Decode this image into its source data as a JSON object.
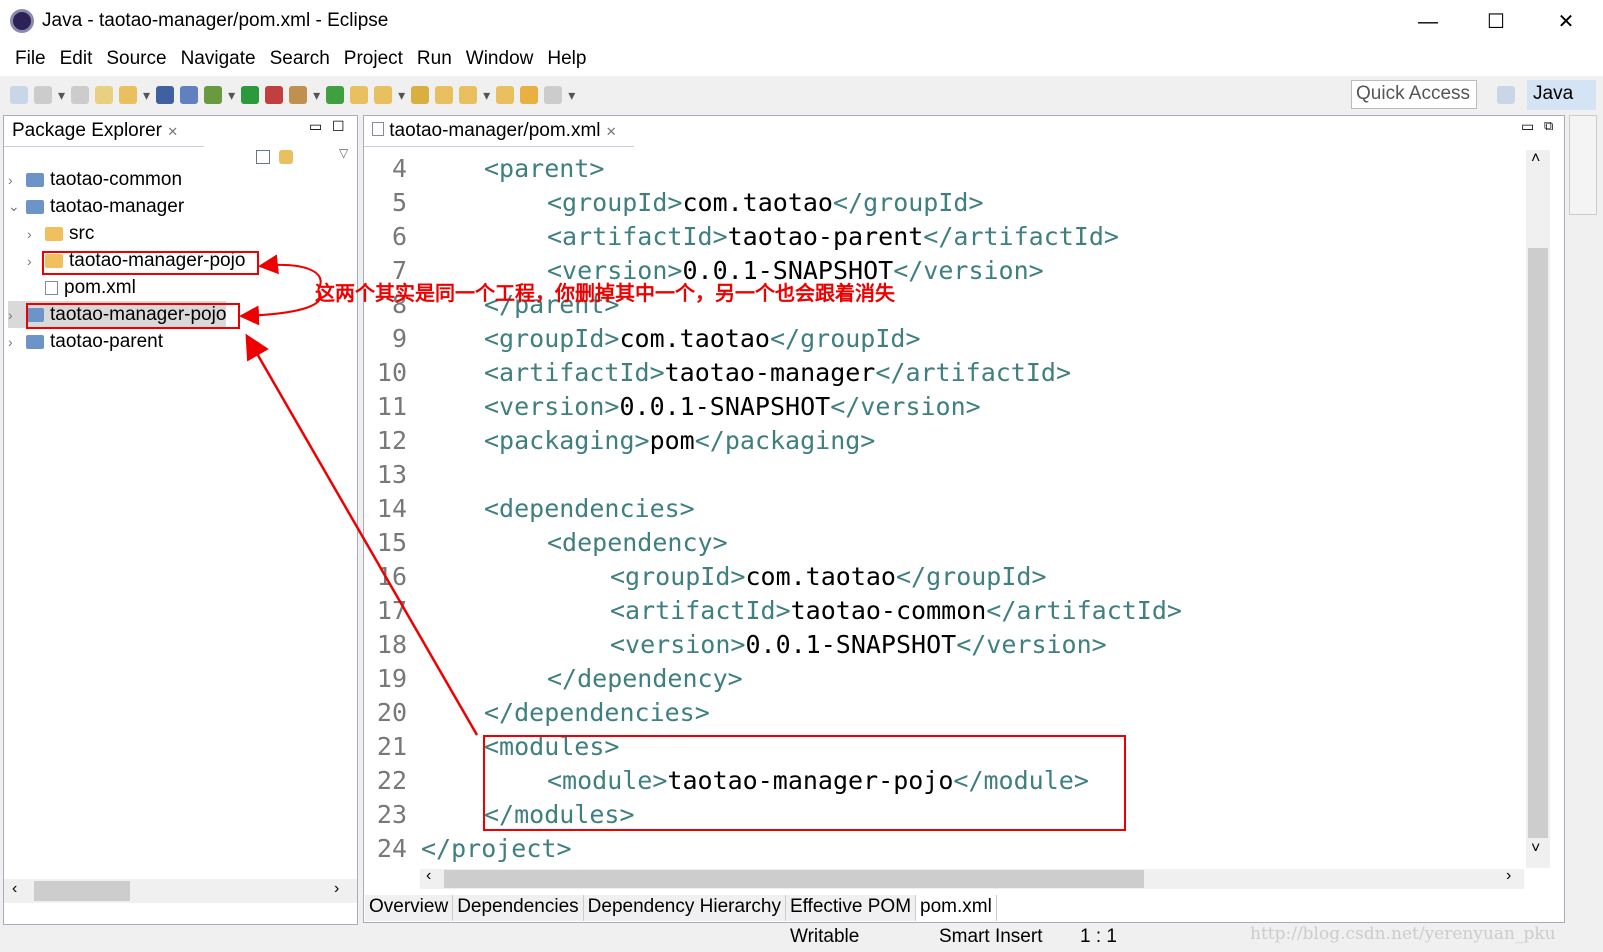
{
  "window": {
    "title": "Java - taotao-manager/pom.xml - Eclipse",
    "minimize": "—",
    "maximize": "☐",
    "close": "✕"
  },
  "menu": [
    "File",
    "Edit",
    "Source",
    "Navigate",
    "Search",
    "Project",
    "Run",
    "Window",
    "Help"
  ],
  "toolbar": {
    "quick_access": "Quick Access",
    "perspective": "Java"
  },
  "package_explorer": {
    "title": "Package Explorer",
    "items": [
      {
        "label": "taotao-common",
        "icon": "maven-project-icon",
        "expanded": false
      },
      {
        "label": "taotao-manager",
        "icon": "maven-project-icon",
        "expanded": true
      },
      {
        "label": "src",
        "icon": "folder-icon",
        "expanded": false
      },
      {
        "label": "taotao-manager-pojo",
        "icon": "folder-icon",
        "expanded": false
      },
      {
        "label": "pom.xml",
        "icon": "pom-file-icon"
      },
      {
        "label": "taotao-manager-pojo",
        "icon": "maven-project-icon",
        "expanded": false,
        "selected": true
      },
      {
        "label": "taotao-parent",
        "icon": "maven-project-icon",
        "expanded": false
      }
    ]
  },
  "editor": {
    "tab": "taotao-manager/pom.xml",
    "lines": [
      {
        "n": "4",
        "indent": 1,
        "parts": [
          [
            "t",
            "<parent>"
          ]
        ]
      },
      {
        "n": "5",
        "indent": 2,
        "parts": [
          [
            "t",
            "<groupId>"
          ],
          [
            "x",
            "com.taotao"
          ],
          [
            "t",
            "</groupId>"
          ]
        ]
      },
      {
        "n": "6",
        "indent": 2,
        "parts": [
          [
            "t",
            "<artifactId>"
          ],
          [
            "x",
            "taotao-parent"
          ],
          [
            "t",
            "</artifactId>"
          ]
        ]
      },
      {
        "n": "7",
        "indent": 2,
        "parts": [
          [
            "t",
            "<version>"
          ],
          [
            "x",
            "0.0.1-SNAPSHOT"
          ],
          [
            "t",
            "</version>"
          ]
        ]
      },
      {
        "n": "8",
        "indent": 1,
        "parts": [
          [
            "t",
            "</parent>"
          ]
        ]
      },
      {
        "n": "9",
        "indent": 1,
        "parts": [
          [
            "t",
            "<groupId>"
          ],
          [
            "x",
            "com.taotao"
          ],
          [
            "t",
            "</groupId>"
          ]
        ]
      },
      {
        "n": "10",
        "indent": 1,
        "parts": [
          [
            "t",
            "<artifactId>"
          ],
          [
            "x",
            "taotao-manager"
          ],
          [
            "t",
            "</artifactId>"
          ]
        ]
      },
      {
        "n": "11",
        "indent": 1,
        "parts": [
          [
            "t",
            "<version>"
          ],
          [
            "x",
            "0.0.1-SNAPSHOT"
          ],
          [
            "t",
            "</version>"
          ]
        ]
      },
      {
        "n": "12",
        "indent": 1,
        "parts": [
          [
            "t",
            "<packaging>"
          ],
          [
            "x",
            "pom"
          ],
          [
            "t",
            "</packaging>"
          ]
        ]
      },
      {
        "n": "13",
        "indent": 1,
        "parts": []
      },
      {
        "n": "14",
        "indent": 1,
        "parts": [
          [
            "t",
            "<dependencies>"
          ]
        ]
      },
      {
        "n": "15",
        "indent": 2,
        "parts": [
          [
            "t",
            "<dependency>"
          ]
        ]
      },
      {
        "n": "16",
        "indent": 3,
        "parts": [
          [
            "t",
            "<groupId>"
          ],
          [
            "x",
            "com.taotao"
          ],
          [
            "t",
            "</groupId>"
          ]
        ]
      },
      {
        "n": "17",
        "indent": 3,
        "parts": [
          [
            "t",
            "<artifactId>"
          ],
          [
            "x",
            "taotao-common"
          ],
          [
            "t",
            "</artifactId>"
          ]
        ]
      },
      {
        "n": "18",
        "indent": 3,
        "parts": [
          [
            "t",
            "<version>"
          ],
          [
            "x",
            "0.0.1-SNAPSHOT"
          ],
          [
            "t",
            "</version>"
          ]
        ]
      },
      {
        "n": "19",
        "indent": 2,
        "parts": [
          [
            "t",
            "</dependency>"
          ]
        ]
      },
      {
        "n": "20",
        "indent": 1,
        "parts": [
          [
            "t",
            "</dependencies>"
          ]
        ]
      },
      {
        "n": "21",
        "indent": 1,
        "parts": [
          [
            "t",
            "<modules>"
          ]
        ]
      },
      {
        "n": "22",
        "indent": 2,
        "parts": [
          [
            "t",
            "<module>"
          ],
          [
            "x",
            "taotao-manager-pojo"
          ],
          [
            "t",
            "</module>"
          ]
        ]
      },
      {
        "n": "23",
        "indent": 1,
        "parts": [
          [
            "t",
            "</modules>"
          ]
        ]
      },
      {
        "n": "24",
        "indent": 0,
        "parts": [
          [
            "t",
            "</project>"
          ]
        ]
      }
    ],
    "bottom_tabs": [
      "Overview",
      "Dependencies",
      "Dependency Hierarchy",
      "Effective POM",
      "pom.xml"
    ],
    "active_bottom_tab": "pom.xml"
  },
  "status": {
    "writable": "Writable",
    "insert_mode": "Smart Insert",
    "position": "1 : 1"
  },
  "annotation": "这两个其实是同一个工程，你删掉其中一个，另一个也会跟着消失",
  "watermark": "http://blog.csdn.net/yerenyuan_pku",
  "colors": {
    "tag": "#3f7f7f",
    "annotation": "#ee0000",
    "selection": "#d9d9d9"
  }
}
